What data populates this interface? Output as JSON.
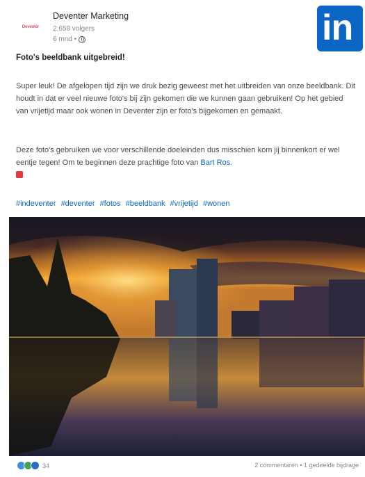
{
  "company": {
    "name": "Deventer Marketing",
    "followers": "2.658 volgers",
    "time": "6 mnd •",
    "logo_text": "Deventer"
  },
  "brand": {
    "linkedin_logo": "in"
  },
  "post": {
    "title": "Foto's beeldbank uitgebreid!",
    "paragraph1": "Super leuk! De afgelopen tijd zijn we druk bezig geweest met het uitbreiden van onze beeldbank. Dit houdt in dat er veel nieuwe foto's bij zijn gekomen die we kunnen gaan gebruiken! Op het gebied van vrijetijd maar ook wonen in Deventer zijn er foto's bijgekomen en gemaakt.",
    "paragraph2": "Deze foto's gebruiken we voor verschillende doeleinden dus misschien kom jij binnenkort er wel eentje tegen! Om te beginnen deze prachtige foto van ",
    "mention": "Bart Ros.",
    "hashtags": [
      "#indeventer",
      "#deventer",
      "#fotos",
      "#beeldbank",
      "#vrijetijd",
      "#wonen"
    ]
  },
  "footer": {
    "reaction_count": "34",
    "stats": "2 commentaren • 1 gedeelde bijdrage"
  },
  "colors": {
    "linkedin_blue": "#0a66c2",
    "hashtag_blue": "#0a66c2",
    "heart_red": "#e23b3b"
  },
  "icons": [
    "globe-icon",
    "heart-emoji-icon",
    "like-reaction-icon",
    "celebrate-reaction-icon",
    "support-reaction-icon",
    "linkedin-logo-icon"
  ]
}
